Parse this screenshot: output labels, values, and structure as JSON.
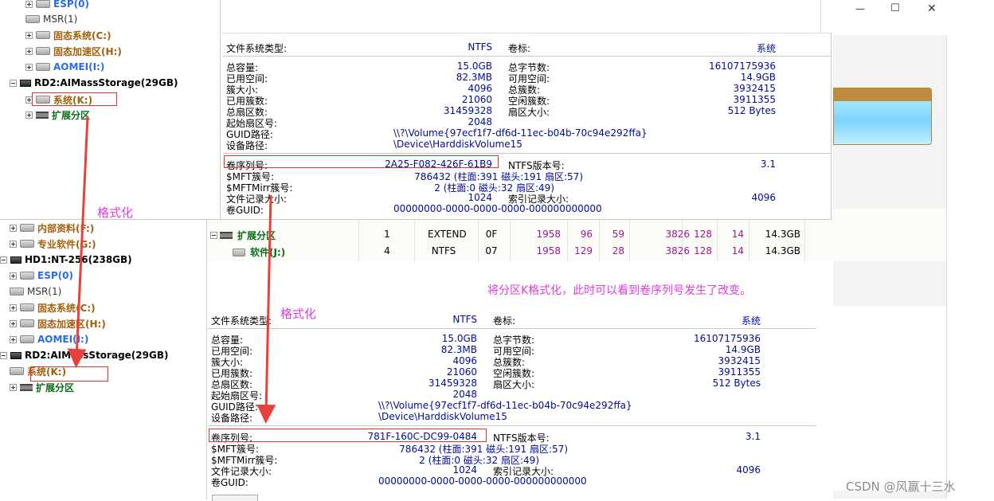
{
  "window": {
    "minimize_glyph": "—",
    "maximize_glyph": "☐",
    "close_glyph": "✕"
  },
  "tree_top": {
    "items": [
      {
        "label": "ESP(0)",
        "style": "blue"
      },
      {
        "label": "MSR(1)",
        "style": "gray"
      },
      {
        "label": "固态系统(C:)",
        "style": "orange"
      },
      {
        "label": "固态加速区(H:)",
        "style": "orange"
      },
      {
        "label": "AOMEI(I:)",
        "style": "blue"
      },
      {
        "label": "RD2:AIMassStorage(29GB)",
        "style": "black"
      },
      {
        "label": "系统(K:)",
        "style": "orange"
      },
      {
        "label": "扩展分区",
        "style": "green"
      }
    ]
  },
  "tree_bottom": {
    "items": [
      {
        "label": "内部资料(F:)",
        "style": "orange"
      },
      {
        "label": "专业软件(G:)",
        "style": "orange"
      },
      {
        "label": "HD1:NT-256(238GB)",
        "style": "black"
      },
      {
        "label": "ESP(0)",
        "style": "blue"
      },
      {
        "label": "MSR(1)",
        "style": "gray"
      },
      {
        "label": "固态系统(C:)",
        "style": "orange"
      },
      {
        "label": "固态加速区(H:)",
        "style": "orange"
      },
      {
        "label": "AOMEI(I:)",
        "style": "blue"
      },
      {
        "label": "RD2:AIMassStorage(29GB)",
        "style": "black"
      },
      {
        "label": "系统(K:)",
        "style": "orange"
      },
      {
        "label": "扩展分区",
        "style": "green"
      }
    ]
  },
  "partition_rows": [
    {
      "name": "扩展分区",
      "seq": "1",
      "fs": "EXTEND",
      "id": "0F",
      "c1": "1958",
      "h1": "96",
      "s1": "59",
      "c2": "3826",
      "h2": "128",
      "s2": "14",
      "size": "14.3GB"
    },
    {
      "name": "软件(J:)",
      "seq": "4",
      "fs": "NTFS",
      "id": "07",
      "c1": "1958",
      "h1": "129",
      "s1": "28",
      "c2": "3826",
      "h2": "128",
      "s2": "14",
      "size": "14.3GB"
    }
  ],
  "info_before": {
    "fs_type_label": "文件系统类型:",
    "fs_type": "NTFS",
    "volume_label_label": "卷标:",
    "volume_label": "系统",
    "left": [
      {
        "k": "总容量:",
        "v": "15.0GB"
      },
      {
        "k": "已用空间:",
        "v": "82.3MB"
      },
      {
        "k": "簇大小:",
        "v": "4096"
      },
      {
        "k": "已用簇数:",
        "v": "21060"
      },
      {
        "k": "总扇区数:",
        "v": "31459328"
      },
      {
        "k": "起始扇区号:",
        "v": "2048"
      }
    ],
    "right": [
      {
        "k": "总字节数:",
        "v": "16107175936"
      },
      {
        "k": "可用空间:",
        "v": "14.9GB"
      },
      {
        "k": "总簇数:",
        "v": "3932415"
      },
      {
        "k": "空闲簇数:",
        "v": "3911355"
      },
      {
        "k": "扇区大小:",
        "v": "512 Bytes"
      }
    ],
    "guid_label": "GUID路径:",
    "guid": "\\\\?\\Volume{97ecf1f7-df6d-11ec-b04b-70c94e292ffa}",
    "dev_label": "设备路径:",
    "dev": "\\Device\\HarddiskVolume15",
    "serial_label": "卷序列号:",
    "serial": "2A25-F082-426F-61B9",
    "ntfs_ver_label": "NTFS版本号:",
    "ntfs_ver": "3.1",
    "mft_label": "$MFT簇号:",
    "mft": "786432 (柱面:391 磁头:191 扇区:57)",
    "mftmirr_label": "$MFTMirr簇号:",
    "mftmirr": "2 (柱面:0 磁头:32 扇区:49)",
    "rec_size_label": "文件记录大小:",
    "rec_size": "1024",
    "idx_size_label": "索引记录大小:",
    "idx_size": "4096",
    "vol_guid_label": "卷GUID:",
    "vol_guid": "00000000-0000-0000-0000-000000000000"
  },
  "info_after": {
    "fs_type_label": "文件系统类型:",
    "fs_type": "NTFS",
    "volume_label_label": "卷标:",
    "volume_label": "系统",
    "left": [
      {
        "k": "总容量:",
        "v": "15.0GB"
      },
      {
        "k": "已用空间:",
        "v": "82.3MB"
      },
      {
        "k": "簇大小:",
        "v": "4096"
      },
      {
        "k": "已用簇数:",
        "v": "21060"
      },
      {
        "k": "总扇区数:",
        "v": "31459328"
      },
      {
        "k": "起始扇区号:",
        "v": "2048"
      }
    ],
    "right": [
      {
        "k": "总字节数:",
        "v": "16107175936"
      },
      {
        "k": "可用空间:",
        "v": "14.9GB"
      },
      {
        "k": "总簇数:",
        "v": "3932415"
      },
      {
        "k": "空闲簇数:",
        "v": "3911355"
      },
      {
        "k": "扇区大小:",
        "v": "512 Bytes"
      }
    ],
    "guid_label": "GUID路径:",
    "guid": "\\\\?\\Volume{97ecf1f7-df6d-11ec-b04b-70c94e292ffa}",
    "dev_label": "设备路径:",
    "dev": "\\Device\\HarddiskVolume15",
    "serial_label": "卷序列号:",
    "serial": "781F-160C-DC99-0484",
    "ntfs_ver_label": "NTFS版本号:",
    "ntfs_ver": "3.1",
    "mft_label": "$MFT簇号:",
    "mft": "786432 (柱面:391 磁头:191 扇区:57)",
    "mftmirr_label": "$MFTMirr簇号:",
    "mftmirr": "2 (柱面:0 磁头:32 扇区:49)",
    "rec_size_label": "文件记录大小:",
    "rec_size": "1024",
    "idx_size_label": "索引记录大小:",
    "idx_size": "4096",
    "vol_guid_label": "卷GUID:",
    "vol_guid": "00000000-0000-0000-0000-000000000000"
  },
  "annotations": {
    "format1": "格式化",
    "format2": "格式化",
    "note": "将分区K格式化，此时可以看到卷序列号发生了改变。",
    "watermark": "CSDN @风赢十三水"
  },
  "colors": {
    "annotation": "#e03ce0",
    "arrow": "#e8403a",
    "value": "#000c9a"
  }
}
